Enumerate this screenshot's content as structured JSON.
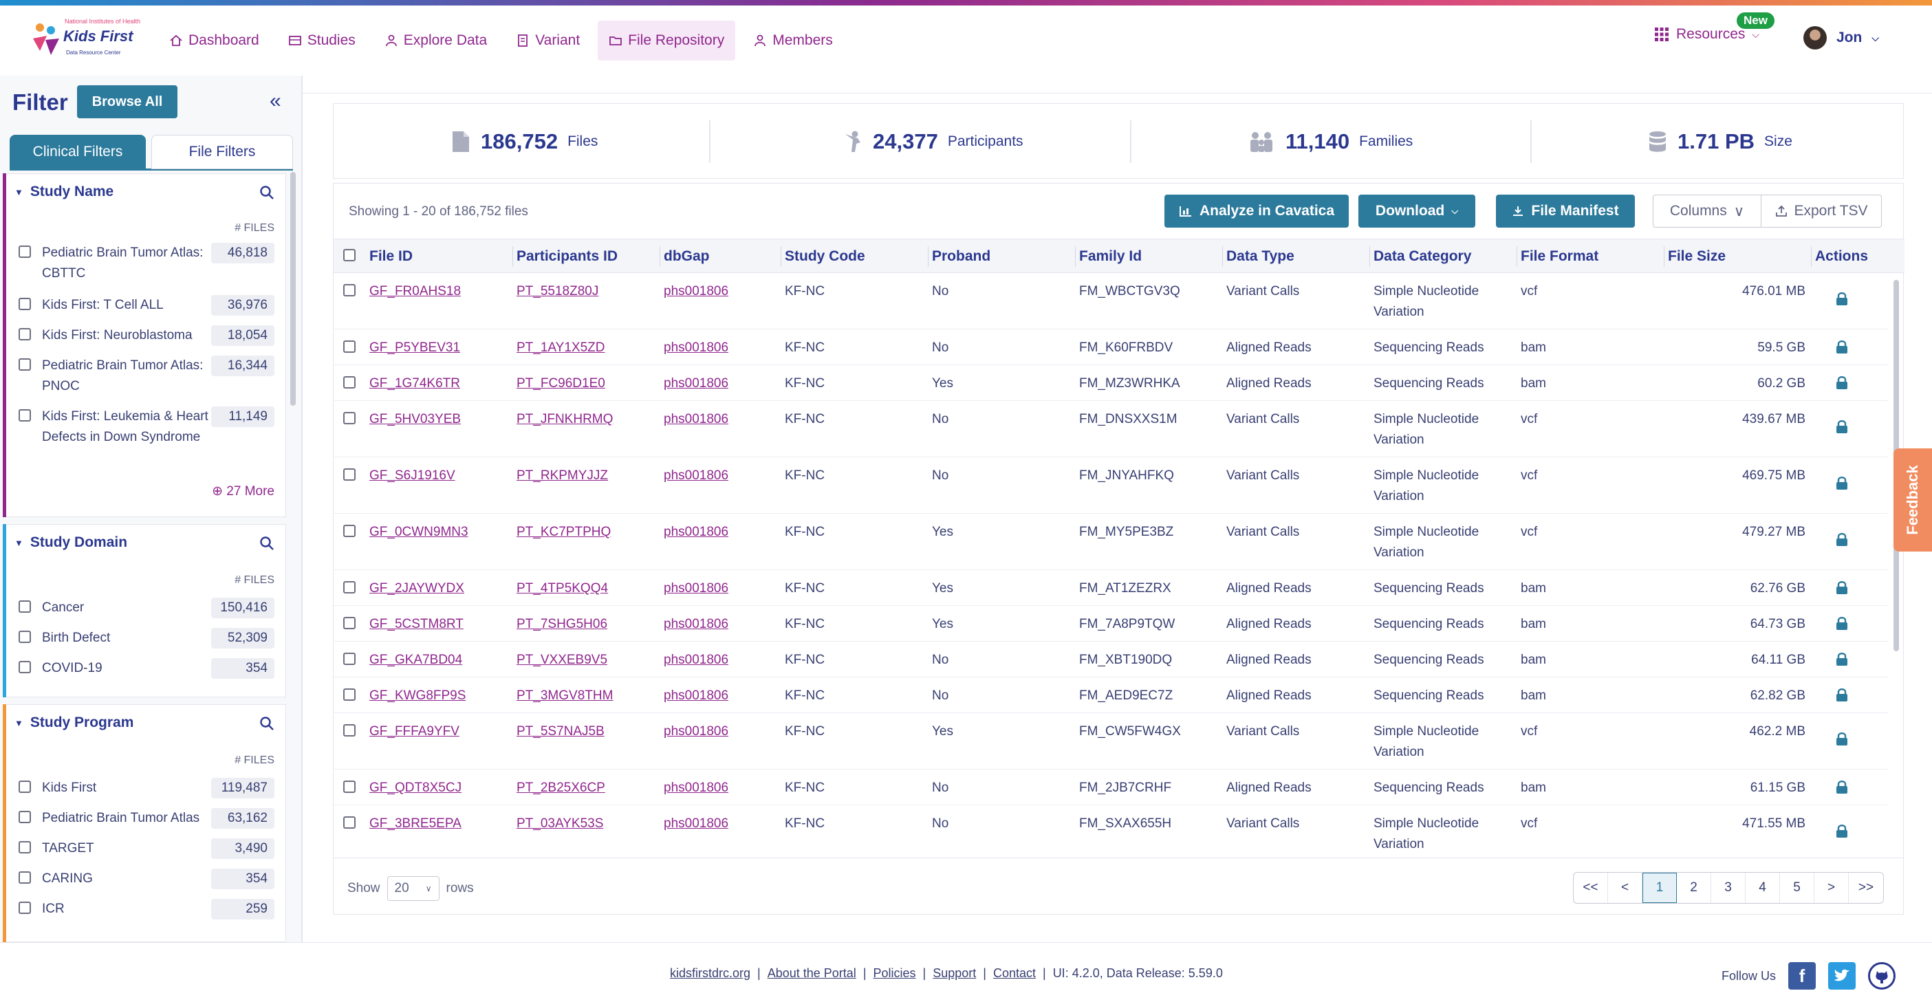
{
  "logo": {
    "top_text": "National Institutes of Health",
    "name": "Kids First",
    "sub": "Data Resource Center"
  },
  "nav": [
    {
      "label": "Dashboard",
      "icon": "home-icon"
    },
    {
      "label": "Studies",
      "icon": "studies-icon"
    },
    {
      "label": "Explore Data",
      "icon": "explore-icon"
    },
    {
      "label": "Variant",
      "icon": "variant-icon"
    },
    {
      "label": "File Repository",
      "icon": "folder-icon",
      "active": true
    },
    {
      "label": "Members",
      "icon": "members-icon"
    }
  ],
  "resources": {
    "label": "Resources",
    "badge": "New"
  },
  "user": {
    "name": "Jon"
  },
  "sidebar": {
    "title": "Filter",
    "browse_all": "Browse All",
    "tabs": [
      "Clinical Filters",
      "File Filters"
    ],
    "files_header": "# FILES",
    "panels": [
      {
        "title": "Study Name",
        "color": "#90278e",
        "items": [
          {
            "label": "Pediatric Brain Tumor Atlas: CBTTC",
            "count": "46,818"
          },
          {
            "label": "Kids First: T Cell ALL",
            "count": "36,976"
          },
          {
            "label": "Kids First: Neuroblastoma",
            "count": "18,054"
          },
          {
            "label": "Pediatric Brain Tumor Atlas: PNOC",
            "count": "16,344"
          },
          {
            "label": "Kids First: Leukemia & Heart Defects in Down Syndrome",
            "count": "11,149"
          }
        ],
        "more": "27 More"
      },
      {
        "title": "Study Domain",
        "color": "#2ea6dc",
        "items": [
          {
            "label": "Cancer",
            "count": "150,416"
          },
          {
            "label": "Birth Defect",
            "count": "52,309"
          },
          {
            "label": "COVID-19",
            "count": "354"
          }
        ]
      },
      {
        "title": "Study Program",
        "color": "#f2983b",
        "items": [
          {
            "label": "Kids First",
            "count": "119,487"
          },
          {
            "label": "Pediatric Brain Tumor Atlas",
            "count": "63,162"
          },
          {
            "label": "TARGET",
            "count": "3,490"
          },
          {
            "label": "CARING",
            "count": "354"
          },
          {
            "label": "ICR",
            "count": "259"
          }
        ]
      }
    ]
  },
  "stats": [
    {
      "value": "186,752",
      "label": "Files",
      "icon": "file-icon"
    },
    {
      "value": "24,377",
      "label": "Participants",
      "icon": "participant-icon"
    },
    {
      "value": "11,140",
      "label": "Families",
      "icon": "family-icon"
    },
    {
      "value": "1.71 PB",
      "label": "Size",
      "icon": "storage-icon"
    }
  ],
  "table": {
    "showing": "Showing 1 - 20 of 186,752 files",
    "buttons": {
      "analyze": "Analyze in Cavatica",
      "download": "Download",
      "manifest": "File Manifest",
      "columns": "Columns",
      "export": "Export TSV"
    },
    "columns": [
      "File ID",
      "Participants ID",
      "dbGap",
      "Study Code",
      "Proband",
      "Family Id",
      "Data Type",
      "Data Category",
      "File Format",
      "File Size",
      "Actions"
    ],
    "rows": [
      {
        "file_id": "GF_FR0AHS18",
        "participant": "PT_5518Z80J",
        "dbgap": "phs001806",
        "study": "KF-NC",
        "proband": "No",
        "family": "FM_WBCTGV3Q",
        "data_type": "Variant Calls",
        "category": "Simple Nucleotide Variation",
        "format": "vcf",
        "size": "476.01 MB"
      },
      {
        "file_id": "GF_P5YBEV31",
        "participant": "PT_1AY1X5ZD",
        "dbgap": "phs001806",
        "study": "KF-NC",
        "proband": "No",
        "family": "FM_K60FRBDV",
        "data_type": "Aligned Reads",
        "category": "Sequencing Reads",
        "format": "bam",
        "size": "59.5 GB"
      },
      {
        "file_id": "GF_1G74K6TR",
        "participant": "PT_FC96D1E0",
        "dbgap": "phs001806",
        "study": "KF-NC",
        "proband": "Yes",
        "family": "FM_MZ3WRHKA",
        "data_type": "Aligned Reads",
        "category": "Sequencing Reads",
        "format": "bam",
        "size": "60.2 GB"
      },
      {
        "file_id": "GF_5HV03YEB",
        "participant": "PT_JFNKHRMQ",
        "dbgap": "phs001806",
        "study": "KF-NC",
        "proband": "No",
        "family": "FM_DNSXXS1M",
        "data_type": "Variant Calls",
        "category": "Simple Nucleotide Variation",
        "format": "vcf",
        "size": "439.67 MB"
      },
      {
        "file_id": "GF_S6J1916V",
        "participant": "PT_RKPMYJJZ",
        "dbgap": "phs001806",
        "study": "KF-NC",
        "proband": "No",
        "family": "FM_JNYAHFKQ",
        "data_type": "Variant Calls",
        "category": "Simple Nucleotide Variation",
        "format": "vcf",
        "size": "469.75 MB"
      },
      {
        "file_id": "GF_0CWN9MN3",
        "participant": "PT_KC7PTPHQ",
        "dbgap": "phs001806",
        "study": "KF-NC",
        "proband": "Yes",
        "family": "FM_MY5PE3BZ",
        "data_type": "Variant Calls",
        "category": "Simple Nucleotide Variation",
        "format": "vcf",
        "size": "479.27 MB"
      },
      {
        "file_id": "GF_2JAYWYDX",
        "participant": "PT_4TP5KQQ4",
        "dbgap": "phs001806",
        "study": "KF-NC",
        "proband": "Yes",
        "family": "FM_AT1ZEZRX",
        "data_type": "Aligned Reads",
        "category": "Sequencing Reads",
        "format": "bam",
        "size": "62.76 GB"
      },
      {
        "file_id": "GF_5CSTM8RT",
        "participant": "PT_7SHG5H06",
        "dbgap": "phs001806",
        "study": "KF-NC",
        "proband": "Yes",
        "family": "FM_7A8P9TQW",
        "data_type": "Aligned Reads",
        "category": "Sequencing Reads",
        "format": "bam",
        "size": "64.73 GB"
      },
      {
        "file_id": "GF_GKA7BD04",
        "participant": "PT_VXXEB9V5",
        "dbgap": "phs001806",
        "study": "KF-NC",
        "proband": "No",
        "family": "FM_XBT190DQ",
        "data_type": "Aligned Reads",
        "category": "Sequencing Reads",
        "format": "bam",
        "size": "64.11 GB"
      },
      {
        "file_id": "GF_KWG8FP9S",
        "participant": "PT_3MGV8THM",
        "dbgap": "phs001806",
        "study": "KF-NC",
        "proband": "No",
        "family": "FM_AED9EC7Z",
        "data_type": "Aligned Reads",
        "category": "Sequencing Reads",
        "format": "bam",
        "size": "62.82 GB"
      },
      {
        "file_id": "GF_FFFA9YFV",
        "participant": "PT_5S7NAJ5B",
        "dbgap": "phs001806",
        "study": "KF-NC",
        "proband": "Yes",
        "family": "FM_CW5FW4GX",
        "data_type": "Variant Calls",
        "category": "Simple Nucleotide Variation",
        "format": "vcf",
        "size": "462.2 MB"
      },
      {
        "file_id": "GF_QDT8X5CJ",
        "participant": "PT_2B25X6CP",
        "dbgap": "phs001806",
        "study": "KF-NC",
        "proband": "No",
        "family": "FM_2JB7CRHF",
        "data_type": "Aligned Reads",
        "category": "Sequencing Reads",
        "format": "bam",
        "size": "61.15 GB"
      },
      {
        "file_id": "GF_3BRE5EPA",
        "participant": "PT_03AYK53S",
        "dbgap": "phs001806",
        "study": "KF-NC",
        "proband": "No",
        "family": "FM_SXAX655H",
        "data_type": "Variant Calls",
        "category": "Simple Nucleotide Variation",
        "format": "vcf",
        "size": "471.55 MB"
      }
    ],
    "pagination": {
      "show": "Show",
      "rows": "rows",
      "page_size": "20",
      "pages": [
        "<<",
        "<",
        "1",
        "2",
        "3",
        "4",
        "5",
        ">",
        ">>"
      ],
      "current": "1"
    }
  },
  "feedback": "Feedback",
  "footer": {
    "links": [
      "kidsfirstdrc.org",
      "About the Portal",
      "Policies",
      "Support",
      "Contact"
    ],
    "version": "UI: 4.2.0, Data Release: 5.59.0",
    "follow": "Follow Us"
  }
}
